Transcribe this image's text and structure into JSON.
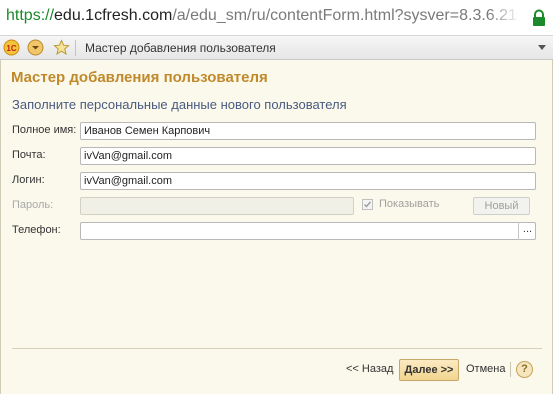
{
  "browser": {
    "url_scheme": "https://",
    "url_host": "edu.1cfresh.com",
    "url_path": "/a/edu_sm/ru/contentForm.html?sysver=8.3.6.21",
    "lock_icon": "lock-icon"
  },
  "toolbar": {
    "logo_icon": "1c-logo-icon",
    "menu_icon": "dropdown-circle-icon",
    "favorite_icon": "star-icon",
    "window_title": "Мастер добавления пользователя"
  },
  "form": {
    "title": "Мастер добавления пользователя",
    "subtitle": "Заполните персональные данные нового пользователя",
    "fields": {
      "full_name": {
        "label": "Полное имя:",
        "value": "Иванов Семен Карпович"
      },
      "email": {
        "label": "Почта:",
        "value": "ivVan@gmail.com"
      },
      "login": {
        "label": "Логин:",
        "value": "ivVan@gmail.com"
      },
      "password": {
        "label": "Пароль:",
        "value": "",
        "show_label": "Показывать",
        "new_button": "Новый"
      },
      "phone": {
        "label": "Телефон:",
        "value": "",
        "choose_button": "..."
      }
    }
  },
  "footer": {
    "back": "<< Назад",
    "next": "Далее >>",
    "cancel": "Отмена",
    "help": "?"
  },
  "colors": {
    "accent_title": "#c0892b",
    "form_background": "#fbf9ec",
    "url_secure": "#1a8a2a"
  }
}
